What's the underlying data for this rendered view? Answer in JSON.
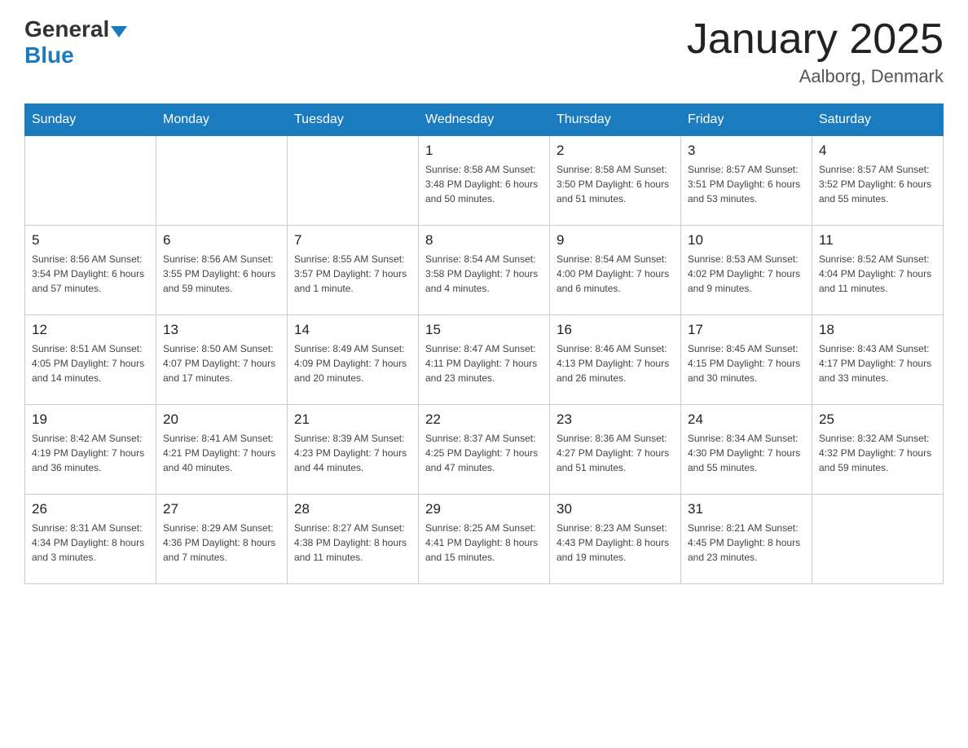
{
  "header": {
    "logo_general": "General",
    "logo_blue": "Blue",
    "title": "January 2025",
    "subtitle": "Aalborg, Denmark"
  },
  "days_of_week": [
    "Sunday",
    "Monday",
    "Tuesday",
    "Wednesday",
    "Thursday",
    "Friday",
    "Saturday"
  ],
  "weeks": [
    [
      {
        "day": "",
        "info": ""
      },
      {
        "day": "",
        "info": ""
      },
      {
        "day": "",
        "info": ""
      },
      {
        "day": "1",
        "info": "Sunrise: 8:58 AM\nSunset: 3:48 PM\nDaylight: 6 hours\nand 50 minutes."
      },
      {
        "day": "2",
        "info": "Sunrise: 8:58 AM\nSunset: 3:50 PM\nDaylight: 6 hours\nand 51 minutes."
      },
      {
        "day": "3",
        "info": "Sunrise: 8:57 AM\nSunset: 3:51 PM\nDaylight: 6 hours\nand 53 minutes."
      },
      {
        "day": "4",
        "info": "Sunrise: 8:57 AM\nSunset: 3:52 PM\nDaylight: 6 hours\nand 55 minutes."
      }
    ],
    [
      {
        "day": "5",
        "info": "Sunrise: 8:56 AM\nSunset: 3:54 PM\nDaylight: 6 hours\nand 57 minutes."
      },
      {
        "day": "6",
        "info": "Sunrise: 8:56 AM\nSunset: 3:55 PM\nDaylight: 6 hours\nand 59 minutes."
      },
      {
        "day": "7",
        "info": "Sunrise: 8:55 AM\nSunset: 3:57 PM\nDaylight: 7 hours\nand 1 minute."
      },
      {
        "day": "8",
        "info": "Sunrise: 8:54 AM\nSunset: 3:58 PM\nDaylight: 7 hours\nand 4 minutes."
      },
      {
        "day": "9",
        "info": "Sunrise: 8:54 AM\nSunset: 4:00 PM\nDaylight: 7 hours\nand 6 minutes."
      },
      {
        "day": "10",
        "info": "Sunrise: 8:53 AM\nSunset: 4:02 PM\nDaylight: 7 hours\nand 9 minutes."
      },
      {
        "day": "11",
        "info": "Sunrise: 8:52 AM\nSunset: 4:04 PM\nDaylight: 7 hours\nand 11 minutes."
      }
    ],
    [
      {
        "day": "12",
        "info": "Sunrise: 8:51 AM\nSunset: 4:05 PM\nDaylight: 7 hours\nand 14 minutes."
      },
      {
        "day": "13",
        "info": "Sunrise: 8:50 AM\nSunset: 4:07 PM\nDaylight: 7 hours\nand 17 minutes."
      },
      {
        "day": "14",
        "info": "Sunrise: 8:49 AM\nSunset: 4:09 PM\nDaylight: 7 hours\nand 20 minutes."
      },
      {
        "day": "15",
        "info": "Sunrise: 8:47 AM\nSunset: 4:11 PM\nDaylight: 7 hours\nand 23 minutes."
      },
      {
        "day": "16",
        "info": "Sunrise: 8:46 AM\nSunset: 4:13 PM\nDaylight: 7 hours\nand 26 minutes."
      },
      {
        "day": "17",
        "info": "Sunrise: 8:45 AM\nSunset: 4:15 PM\nDaylight: 7 hours\nand 30 minutes."
      },
      {
        "day": "18",
        "info": "Sunrise: 8:43 AM\nSunset: 4:17 PM\nDaylight: 7 hours\nand 33 minutes."
      }
    ],
    [
      {
        "day": "19",
        "info": "Sunrise: 8:42 AM\nSunset: 4:19 PM\nDaylight: 7 hours\nand 36 minutes."
      },
      {
        "day": "20",
        "info": "Sunrise: 8:41 AM\nSunset: 4:21 PM\nDaylight: 7 hours\nand 40 minutes."
      },
      {
        "day": "21",
        "info": "Sunrise: 8:39 AM\nSunset: 4:23 PM\nDaylight: 7 hours\nand 44 minutes."
      },
      {
        "day": "22",
        "info": "Sunrise: 8:37 AM\nSunset: 4:25 PM\nDaylight: 7 hours\nand 47 minutes."
      },
      {
        "day": "23",
        "info": "Sunrise: 8:36 AM\nSunset: 4:27 PM\nDaylight: 7 hours\nand 51 minutes."
      },
      {
        "day": "24",
        "info": "Sunrise: 8:34 AM\nSunset: 4:30 PM\nDaylight: 7 hours\nand 55 minutes."
      },
      {
        "day": "25",
        "info": "Sunrise: 8:32 AM\nSunset: 4:32 PM\nDaylight: 7 hours\nand 59 minutes."
      }
    ],
    [
      {
        "day": "26",
        "info": "Sunrise: 8:31 AM\nSunset: 4:34 PM\nDaylight: 8 hours\nand 3 minutes."
      },
      {
        "day": "27",
        "info": "Sunrise: 8:29 AM\nSunset: 4:36 PM\nDaylight: 8 hours\nand 7 minutes."
      },
      {
        "day": "28",
        "info": "Sunrise: 8:27 AM\nSunset: 4:38 PM\nDaylight: 8 hours\nand 11 minutes."
      },
      {
        "day": "29",
        "info": "Sunrise: 8:25 AM\nSunset: 4:41 PM\nDaylight: 8 hours\nand 15 minutes."
      },
      {
        "day": "30",
        "info": "Sunrise: 8:23 AM\nSunset: 4:43 PM\nDaylight: 8 hours\nand 19 minutes."
      },
      {
        "day": "31",
        "info": "Sunrise: 8:21 AM\nSunset: 4:45 PM\nDaylight: 8 hours\nand 23 minutes."
      },
      {
        "day": "",
        "info": ""
      }
    ]
  ]
}
